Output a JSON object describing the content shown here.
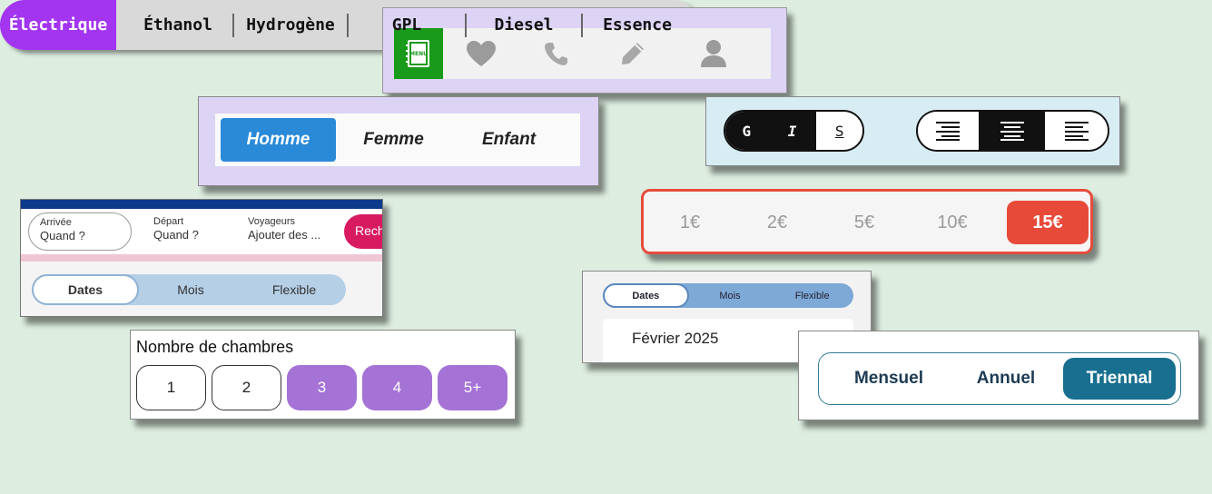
{
  "icon_bar": {
    "menu_icon_text": "MENU",
    "icons": [
      "menu-book-icon",
      "heart-icon",
      "phone-icon",
      "pencil-icon",
      "user-icon"
    ],
    "active_color": "#1a9a1a"
  },
  "gender": {
    "options": [
      "Homme",
      "Femme",
      "Enfant"
    ],
    "selected": "Homme"
  },
  "text_format": {
    "style_buttons": [
      "G",
      "I",
      "S"
    ],
    "align_icons": [
      "align-right-icon",
      "align-center-icon",
      "align-left-icon"
    ]
  },
  "amounts": {
    "options": [
      "1€",
      "2€",
      "5€",
      "10€",
      "15€"
    ],
    "selected": "15€",
    "accent": "#e84a3a"
  },
  "booking": {
    "fields": [
      {
        "label": "Arrivée",
        "value": "Quand ?"
      },
      {
        "label": "Départ",
        "value": "Quand ?"
      },
      {
        "label": "Voyageurs",
        "value": "Ajouter des ..."
      }
    ],
    "search_label": "Rech",
    "tabs": [
      "Dates",
      "Mois",
      "Flexible"
    ],
    "selected_tab": "Dates"
  },
  "calendar": {
    "tabs": [
      "Dates",
      "Mois",
      "Flexible"
    ],
    "selected_tab": "Dates",
    "month_label": "Février 2025"
  },
  "rooms": {
    "title": "Nombre de chambres",
    "options": [
      "1",
      "2",
      "3",
      "4",
      "5+"
    ]
  },
  "billing": {
    "options": [
      "Mensuel",
      "Annuel",
      "Triennal"
    ],
    "selected": "Triennal"
  },
  "fuel": {
    "options": [
      "Électrique",
      "Éthanol",
      "Hydrogène",
      "GPL",
      "Diesel",
      "Essence"
    ],
    "selected": "Électrique"
  }
}
